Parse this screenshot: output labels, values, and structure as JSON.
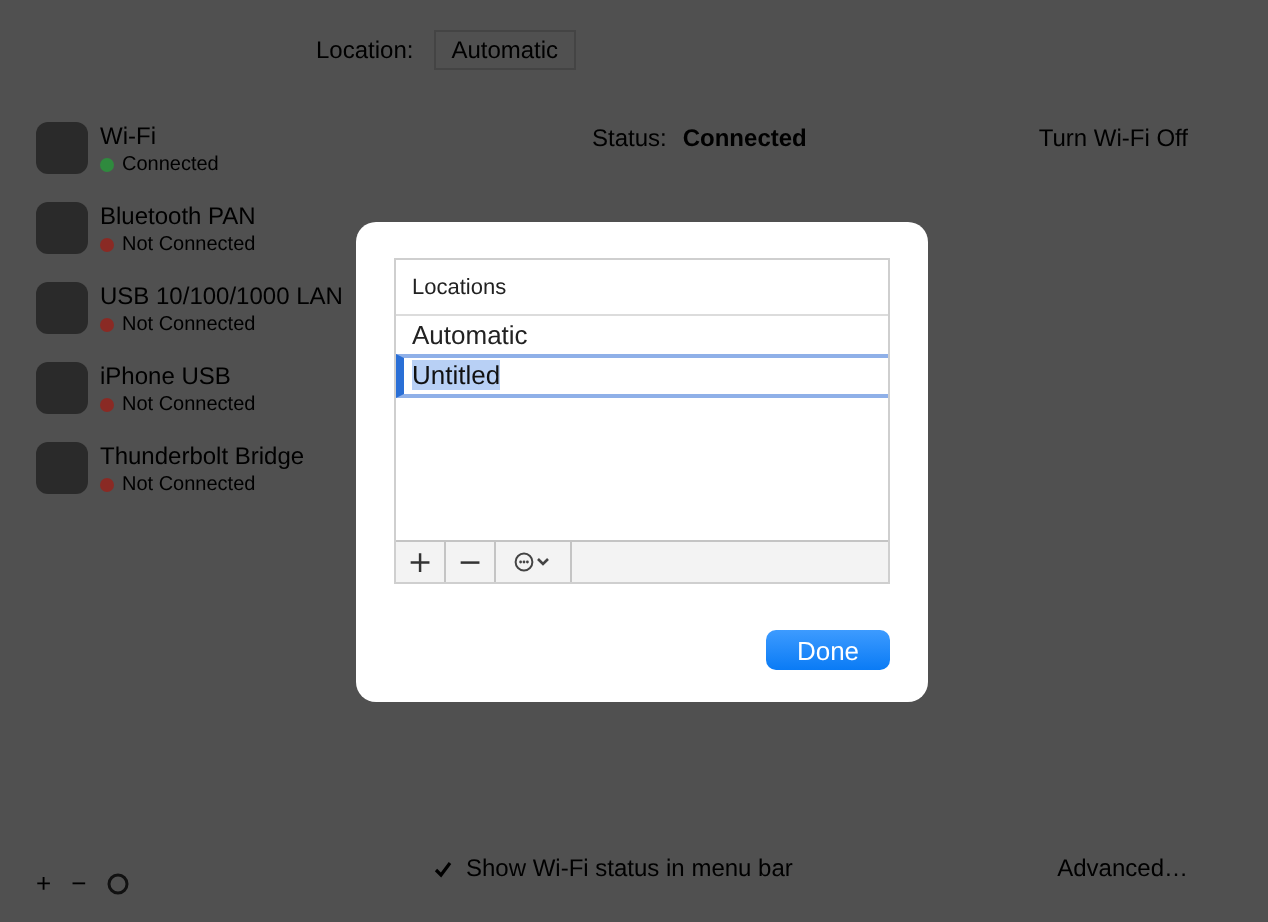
{
  "location": {
    "label": "Location:",
    "value": "Automatic"
  },
  "services": [
    {
      "name": "Wi-Fi",
      "status": "Connected",
      "color": "#2f8a3e"
    },
    {
      "name": "Bluetooth PAN",
      "status": "Not Connected",
      "color": "#8a2a24"
    },
    {
      "name": "USB 10/100/1000 LAN",
      "status": "Not Connected",
      "color": "#8a2a24"
    },
    {
      "name": "iPhone USB",
      "status": "Not Connected",
      "color": "#8a2a24"
    },
    {
      "name": "Thunderbolt Bridge",
      "status": "Not Connected",
      "color": "#8a2a24"
    }
  ],
  "sidebar_toolbar": [
    "+",
    "−"
  ],
  "detail": {
    "status_label": "Status:",
    "status_value": "Connected",
    "turn_off_button": "Turn Wi-Fi Off"
  },
  "show_in_menu_bar": {
    "label": "Show Wi-Fi status in menu bar",
    "checked": true
  },
  "advanced_button": "Advanced…",
  "dialog": {
    "header": "Locations",
    "locations": [
      {
        "name": "Automatic",
        "editing": false
      },
      {
        "name": "Untitled",
        "editing": true
      }
    ],
    "toolbar": [
      "+",
      "−"
    ],
    "done_button": "Done"
  }
}
